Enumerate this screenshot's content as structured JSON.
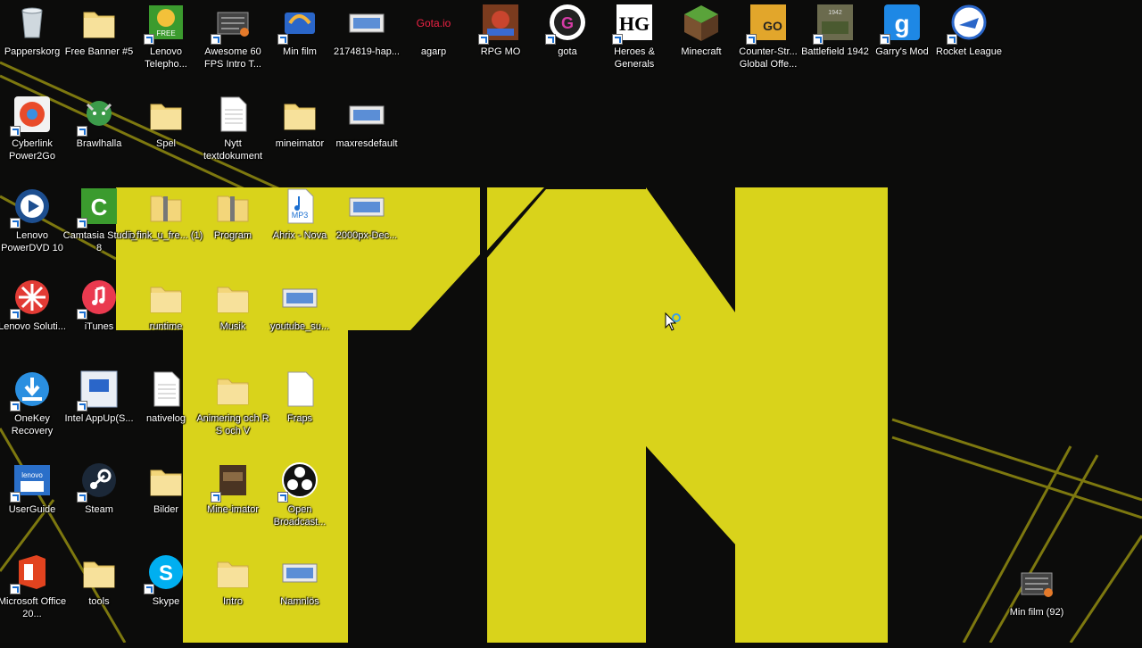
{
  "desktop": {
    "row1": [
      {
        "name": "papperskorg",
        "label": "Papperskorg",
        "icon": "recycle-bin-icon"
      },
      {
        "name": "free-banner",
        "label": "Free Banner #5",
        "icon": "folder-icon"
      },
      {
        "name": "lenovo-telephony",
        "label": "Lenovo Telepho...",
        "icon": "lenovo-telephony-icon"
      },
      {
        "name": "awesome-60fps",
        "label": "Awesome 60 FPS Intro T...",
        "icon": "video-file-icon"
      },
      {
        "name": "min-film",
        "label": "Min film",
        "icon": "movie-maker-icon"
      },
      {
        "name": "happy-image",
        "label": "2174819-hap...",
        "icon": "image-file-icon"
      },
      {
        "name": "agarp",
        "label": "agarp",
        "icon": "agario-icon"
      },
      {
        "name": "rpg-mo",
        "label": "RPG MO",
        "icon": "rpg-mo-icon"
      },
      {
        "name": "gota",
        "label": "gota",
        "icon": "gota-icon"
      },
      {
        "name": "heroes-generals",
        "label": "Heroes & Generals",
        "icon": "heroes-generals-icon"
      },
      {
        "name": "minecraft",
        "label": "Minecraft",
        "icon": "minecraft-icon"
      },
      {
        "name": "counter-strike",
        "label": "Counter-Str... Global Offe...",
        "icon": "csgo-icon"
      },
      {
        "name": "battlefield-1942",
        "label": "Battlefield 1942",
        "icon": "battlefield-icon"
      },
      {
        "name": "garrys-mod",
        "label": "Garry's Mod",
        "icon": "garrys-mod-icon"
      },
      {
        "name": "rocket-league",
        "label": "Rocket League",
        "icon": "rocket-league-icon"
      }
    ],
    "row2": [
      {
        "name": "cyberlink",
        "label": "Cyberlink Power2Go",
        "icon": "cyberlink-icon"
      },
      {
        "name": "brawlhalla",
        "label": "Brawlhalla",
        "icon": "brawlhalla-icon"
      },
      {
        "name": "spel",
        "label": "Spel",
        "icon": "folder-icon"
      },
      {
        "name": "nytt-textdokument",
        "label": "Nytt textdokument",
        "icon": "text-document-icon"
      },
      {
        "name": "mineimator",
        "label": "mineimator",
        "icon": "folder-icon"
      },
      {
        "name": "maxresdefault",
        "label": "maxresdefault",
        "icon": "image-file-icon"
      }
    ],
    "row3": [
      {
        "name": "lenovo-powerdvd",
        "label": "Lenovo PowerDVD 10",
        "icon": "powerdvd-icon"
      },
      {
        "name": "camtasia",
        "label": "Camtasia Studio 8",
        "icon": "camtasia-icon"
      },
      {
        "name": "i-fink-u-free",
        "label": "i_fink_u_fre... (1)",
        "icon": "zip-folder-icon"
      },
      {
        "name": "program",
        "label": "Program",
        "icon": "zip-folder-icon"
      },
      {
        "name": "ahrix-nova",
        "label": "Ahrix - Nova",
        "icon": "mp3-file-icon"
      },
      {
        "name": "2000px-dec",
        "label": "2000px-Dec...",
        "icon": "image-file-icon"
      }
    ],
    "row4": [
      {
        "name": "lenovo-solutions",
        "label": "Lenovo Soluti...",
        "icon": "lenovo-solutions-icon"
      },
      {
        "name": "itunes",
        "label": "iTunes",
        "icon": "itunes-icon"
      },
      {
        "name": "runtime",
        "label": "runtime",
        "icon": "folder-icon"
      },
      {
        "name": "musik",
        "label": "Musik",
        "icon": "folder-icon"
      },
      {
        "name": "youtube-su",
        "label": "youtube_su...",
        "icon": "image-file-icon"
      }
    ],
    "row5": [
      {
        "name": "onekey-recovery",
        "label": "OneKey Recovery",
        "icon": "onekey-icon"
      },
      {
        "name": "intel-appup",
        "label": "Intel AppUp(S...",
        "icon": "intel-appup-icon"
      },
      {
        "name": "nativelog",
        "label": "nativelog",
        "icon": "text-document-icon"
      },
      {
        "name": "animering",
        "label": "Animering och R S och V",
        "icon": "folder-icon"
      },
      {
        "name": "fraps",
        "label": "Fraps",
        "icon": "blank-file-icon"
      }
    ],
    "row6": [
      {
        "name": "userguide",
        "label": "UserGuide",
        "icon": "lenovo-userguide-icon"
      },
      {
        "name": "steam",
        "label": "Steam",
        "icon": "steam-icon"
      },
      {
        "name": "bilder",
        "label": "Bilder",
        "icon": "folder-icon"
      },
      {
        "name": "mine-imator",
        "label": "Mine-imator",
        "icon": "mine-imator-icon"
      },
      {
        "name": "obs",
        "label": "Open Broadcast...",
        "icon": "obs-icon"
      }
    ],
    "row7": [
      {
        "name": "ms-office",
        "label": "Microsoft Office 20...",
        "icon": "office-icon"
      },
      {
        "name": "tools",
        "label": "tools",
        "icon": "folder-icon"
      },
      {
        "name": "skype",
        "label": "Skype",
        "icon": "skype-icon"
      },
      {
        "name": "intro",
        "label": "Intro",
        "icon": "folder-icon"
      },
      {
        "name": "namnlos",
        "label": "Namnlös",
        "icon": "image-file-icon"
      }
    ],
    "right": [
      {
        "name": "min-film-92",
        "label": "Min film (92)",
        "icon": "video-file-icon"
      }
    ]
  },
  "colors": {
    "wallpaper_yellow": "#d8d21a",
    "wallpaper_dark": "#0b0b0a",
    "folder": "#f3d67a"
  }
}
